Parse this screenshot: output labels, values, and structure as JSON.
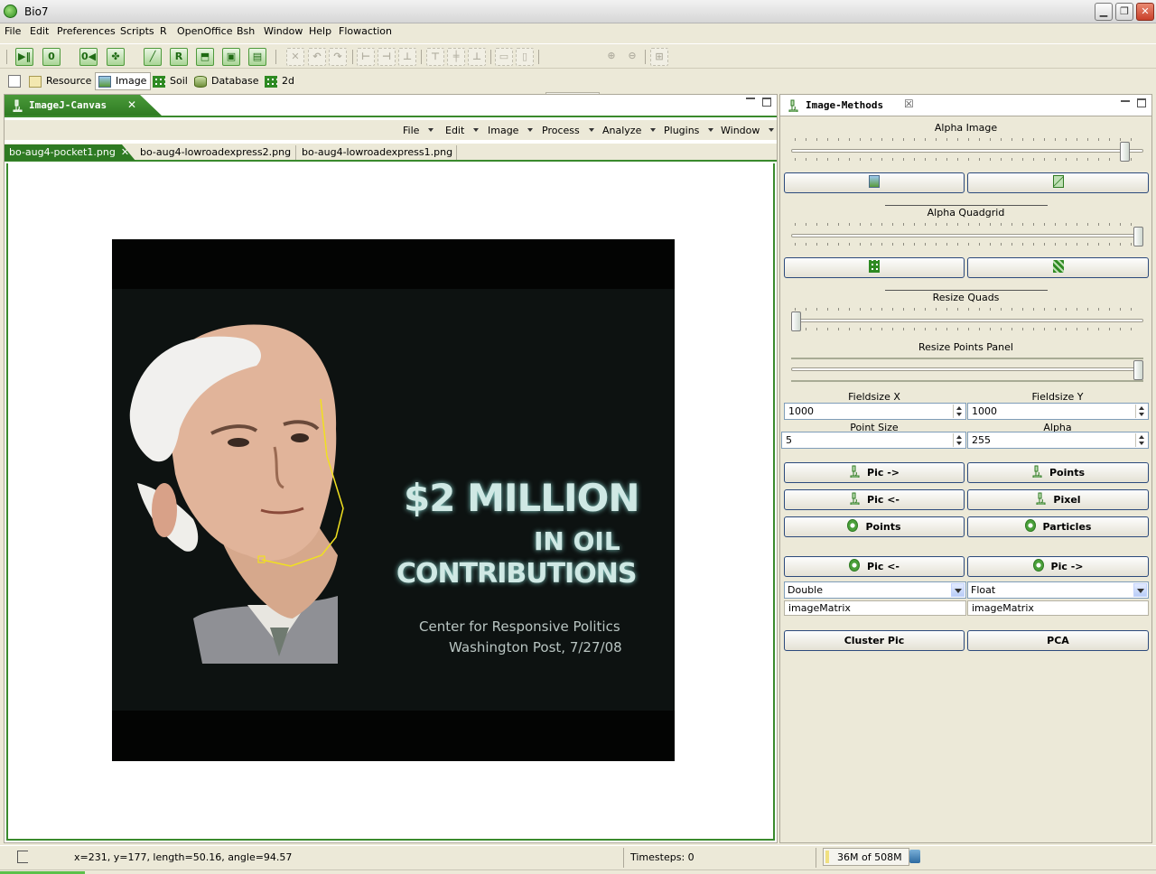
{
  "window": {
    "title": "Bio7"
  },
  "menubar": [
    "File",
    "Edit",
    "Preferences",
    "Scripts",
    "R",
    "OpenOffice",
    "Bsh",
    "Window",
    "Help",
    "Flowaction"
  ],
  "toolbar": {
    "icons": [
      "play-pause-icon",
      "r-zero-icon",
      "dropdown-icon",
      "step-icon",
      "plant-icon",
      "dropdown-icon",
      "line-icon",
      "r-script-icon",
      "export-icon",
      "save-icon",
      "print-icon",
      "delete-icon",
      "undo-icon",
      "redo-icon",
      "tree-icon"
    ],
    "zoom_value": ""
  },
  "perspectives": [
    {
      "label": "Resource",
      "icon": "resource-icon",
      "active": false
    },
    {
      "label": "Image",
      "icon": "image-icon",
      "active": true
    },
    {
      "label": "Soil",
      "icon": "grid-icon",
      "active": false
    },
    {
      "label": "Database",
      "icon": "database-icon",
      "active": false
    },
    {
      "label": "2d",
      "icon": "grid-icon",
      "active": false
    }
  ],
  "left_view": {
    "tab_title": "ImageJ-Canvas",
    "imagej_menu": [
      "File",
      "Edit",
      "Image",
      "Process",
      "Analyze",
      "Plugins",
      "Window"
    ],
    "image_tabs": [
      "bo-aug4-pocket1.png",
      "bo-aug4-lowroadexpress2.png",
      "bo-aug4-lowroadexpress1.png"
    ],
    "active_image_tab": 0,
    "image": {
      "headline_1": "$2 MILLION",
      "headline_2": "IN OIL",
      "headline_3": "CONTRIBUTIONS",
      "source_1": "Center for Responsive Politics",
      "source_2": "Washington Post, 7/27/08"
    }
  },
  "right_view": {
    "tab_title": "Image-Methods",
    "alpha_image_label": "Alpha Image",
    "alpha_image_level": 0.93,
    "alpha_quadgrid_label": "Alpha Quadgrid",
    "alpha_quadgrid_level": 1.0,
    "resize_quads_label": "Resize Quads",
    "resize_quads_level": 0.0,
    "resize_points_label": "Resize Points Panel",
    "resize_points_level": 1.0,
    "fieldsize_x_label": "Fieldsize X",
    "fieldsize_x": "1000",
    "fieldsize_y_label": "Fieldsize Y",
    "fieldsize_y": "1000",
    "point_size_label": "Point Size",
    "point_size": "5",
    "alpha_label": "Alpha",
    "alpha": "255",
    "buttons": {
      "pic_to": "Pic ->",
      "points": "Points",
      "pic_from": "Pic <-",
      "pixel": "Pixel",
      "r_points": "Points",
      "r_particles": "Particles",
      "r_pic_from": "Pic <-",
      "r_pic_to": "Pic ->",
      "cluster_pic": "Cluster Pic",
      "pca": "PCA"
    },
    "type_left": "Double",
    "type_right": "Float",
    "matrix_left": "imageMatrix",
    "matrix_right": "imageMatrix"
  },
  "status": {
    "measure": "x=231, y=177, length=50.16, angle=94.57",
    "timesteps": "Timesteps: 0",
    "memory": "36M of 508M"
  },
  "colors": {
    "accent": "#2e7a22",
    "button_border": "#2c4a7c"
  }
}
